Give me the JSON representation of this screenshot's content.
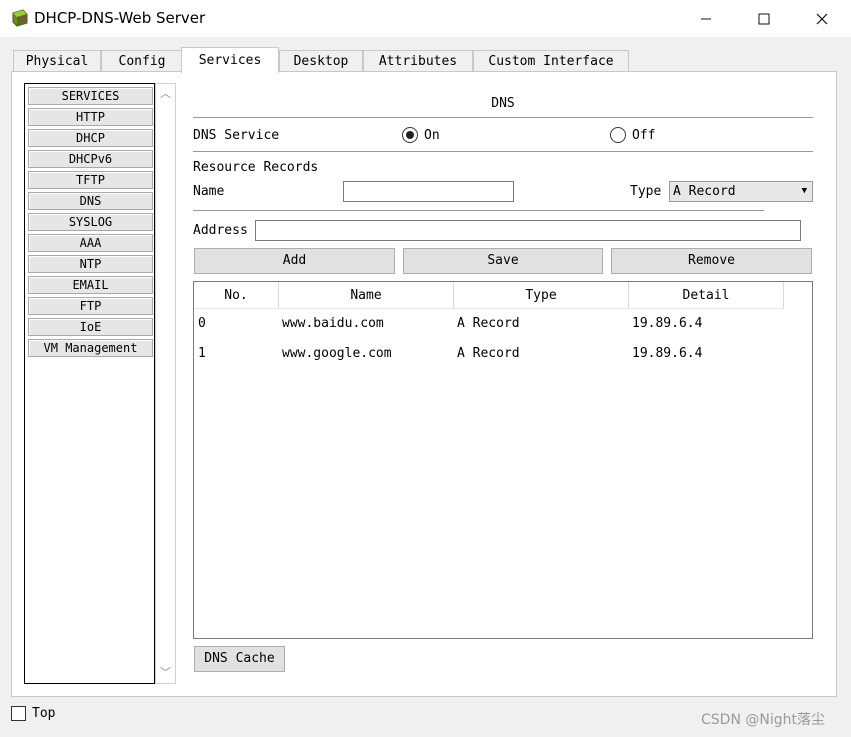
{
  "window": {
    "title": "DHCP-DNS-Web Server",
    "icon": "router-server-icon",
    "controls": {
      "minimize": "—",
      "maximize": "☐",
      "close": "✕"
    }
  },
  "tabs": [
    {
      "label": "Physical",
      "active": false
    },
    {
      "label": "Config",
      "active": false
    },
    {
      "label": "Services",
      "active": true
    },
    {
      "label": "Desktop",
      "active": false
    },
    {
      "label": "Attributes",
      "active": false
    },
    {
      "label": "Custom Interface",
      "active": false
    }
  ],
  "services": {
    "header": "SERVICES",
    "items": [
      "HTTP",
      "DHCP",
      "DHCPv6",
      "TFTP",
      "DNS",
      "SYSLOG",
      "AAA",
      "NTP",
      "EMAIL",
      "FTP",
      "IoE",
      "VM Management"
    ],
    "selected": "DNS",
    "scroll_up": "︿",
    "scroll_down": "﹀"
  },
  "dns": {
    "section_title": "DNS",
    "service_label": "DNS Service",
    "on_label": "On",
    "off_label": "Off",
    "service_state": "On",
    "resource_records_label": "Resource Records",
    "name_label": "Name",
    "name_value": "",
    "type_label": "Type",
    "type_value": "A Record",
    "type_arrow": "▼",
    "address_label": "Address",
    "address_value": "",
    "buttons": {
      "add": "Add",
      "save": "Save",
      "remove": "Remove"
    },
    "table": {
      "columns": [
        "No.",
        "Name",
        "Type",
        "Detail"
      ],
      "rows": [
        {
          "no": "0",
          "name": "www.baidu.com",
          "type": "A Record",
          "detail": "19.89.6.4"
        },
        {
          "no": "1",
          "name": "www.google.com",
          "type": "A Record",
          "detail": "19.89.6.4"
        }
      ]
    },
    "cache_button": "DNS Cache"
  },
  "footer": {
    "top_checkbox_label": "Top",
    "top_checked": false,
    "watermark": "CSDN @Night落尘"
  },
  "colors": {
    "titlebar_bg": "#ffffff",
    "window_bg": "#f0f0f0",
    "panel_bg": "#ffffff",
    "button_bg": "#e1e1e1",
    "service_button_bg": "#e6e6e6"
  }
}
